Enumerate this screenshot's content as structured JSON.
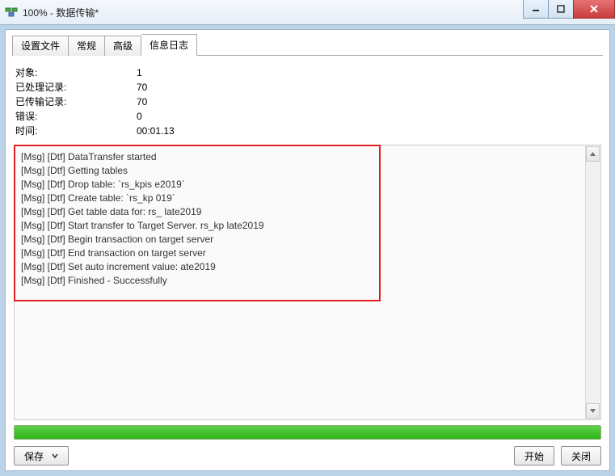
{
  "window": {
    "title": "100% - 数据传输*"
  },
  "tabs": {
    "t0": "设置文件",
    "t1": "常规",
    "t2": "高级",
    "t3": "信息日志",
    "activeIndex": 3
  },
  "stats": {
    "labels": {
      "objects": "对象:",
      "processed": "已处理记录:",
      "transferred": "已传输记录:",
      "errors": "错误:",
      "time": "时间:"
    },
    "values": {
      "objects": "1",
      "processed": "70",
      "transferred": "70",
      "errors": "0",
      "time": "00:01.13"
    }
  },
  "log": {
    "lines": [
      "[Msg] [Dtf] DataTransfer started",
      "[Msg] [Dtf] Getting tables",
      "[Msg] [Dtf] Drop table: `rs_kpis                           e2019`",
      "[Msg] [Dtf] Create table: `rs_kp                            019`",
      "[Msg] [Dtf] Get table data for: rs_                                   late2019",
      "[Msg] [Dtf] Start transfer to Target Server. rs_kp                         late2019",
      "[Msg] [Dtf] Begin transaction on target server",
      "[Msg] [Dtf] End transaction on target server",
      "[Msg] [Dtf] Set auto increment value:                               ate2019",
      "[Msg] [Dtf] Finished - Successfully"
    ]
  },
  "buttons": {
    "save": "保存",
    "start": "开始",
    "close": "关闭"
  },
  "progress": {
    "percent": 100
  }
}
